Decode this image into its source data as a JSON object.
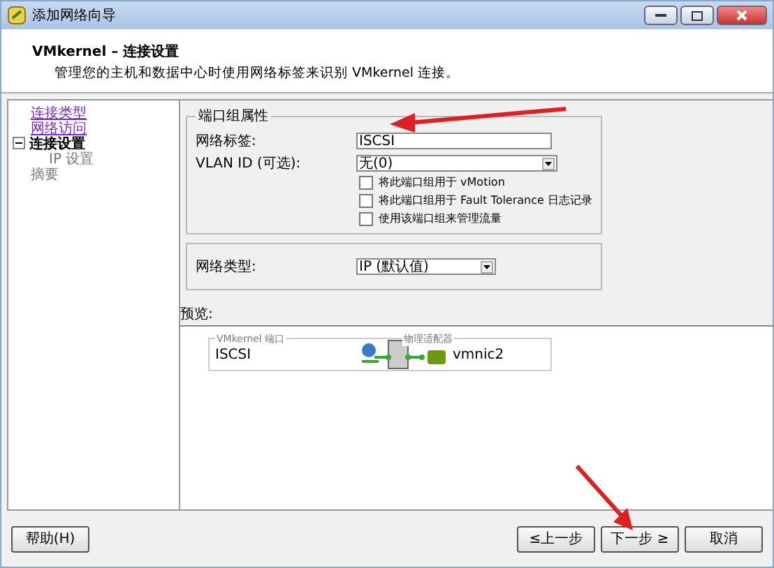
{
  "window": {
    "title": "添加网络向导"
  },
  "header": {
    "title": "VMkernel – 连接设置",
    "subtitle": "管理您的主机和数据中心时使用网络标签来识别 VMkernel 连接。"
  },
  "steps": [
    {
      "label": "连接类型",
      "visited": true,
      "selected": false
    },
    {
      "label": "网络访问",
      "visited": true,
      "selected": false
    },
    {
      "label": "连接设置",
      "visited": false,
      "selected": true,
      "expanded": true,
      "children": [
        {
          "label": "IP 设置",
          "visited": false,
          "selected": false
        }
      ]
    },
    {
      "label": "摘要",
      "visited": false,
      "selected": false
    }
  ],
  "port_group": {
    "legend": "端口组属性",
    "network_label": {
      "label": "网络标签:",
      "value": "ISCSI"
    },
    "vlan": {
      "label": "VLAN ID (可选):",
      "value": "无(0)"
    },
    "options": [
      {
        "label": "将此端口组用于 vMotion",
        "checked": false
      },
      {
        "label": "将此端口组用于 Fault Tolerance 日志记录",
        "checked": false
      },
      {
        "label": "使用该端口组来管理流量",
        "checked": false
      }
    ]
  },
  "network_type": {
    "label": "网络类型:",
    "value": "IP (默认值)"
  },
  "preview": {
    "label": "预览:",
    "port_title": "VMkernel 端口",
    "port_name": "ISCSI",
    "adapter_title": "物理适配器",
    "adapter": "vmnic2"
  },
  "buttons": [
    {
      "label": "帮助(H)",
      "kind": "help"
    },
    {
      "label": "≤上一步",
      "kind": "back"
    },
    {
      "label": "下一步 ≥",
      "kind": "next"
    },
    {
      "label": "取消",
      "kind": "cancel"
    }
  ]
}
